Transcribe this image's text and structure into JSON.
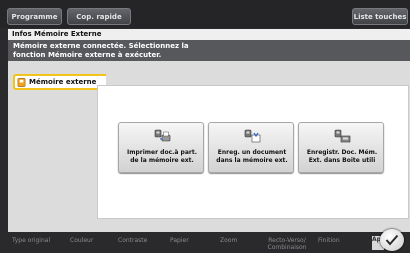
{
  "top_tabs": {
    "programme": "Programme",
    "cop_rapide": "Cop. rapide",
    "liste_touches": "Liste touches"
  },
  "panel": {
    "title": "Infos Mémoire Externe",
    "message_line1": "Mémoire externe connectée. Sélectionnez la",
    "message_line2": "fonction Mémoire externe à exécuter."
  },
  "sidebar": {
    "selected_label": "Mémoire externe",
    "icon": "memory-card-icon"
  },
  "functions": [
    {
      "line1": "Imprimer doc.à part.",
      "line2": "de la mémoire ext.",
      "icon": "print-from-memory-icon"
    },
    {
      "line1": "Enreg. un document",
      "line2": "dans la mémoire ext.",
      "icon": "save-to-memory-icon"
    },
    {
      "line1": "Enregistr. Doc. Mém.",
      "line2": "Ext. dans Boite utili",
      "icon": "save-to-user-box-icon"
    }
  ],
  "bottom_bar": {
    "type_original": "Type original",
    "couleur": "Couleur",
    "contraste": "Contraste",
    "papier": "Papier",
    "zoom": "Zoom",
    "recto_verso_l1": "Recto-Verso/",
    "recto_verso_l2": "Combinaison",
    "finition": "Finition",
    "ap": "Ap"
  },
  "colors": {
    "accent_yellow": "#f2c319",
    "message_bar": "#57585c",
    "panel_bg": "#dcdcdc"
  }
}
